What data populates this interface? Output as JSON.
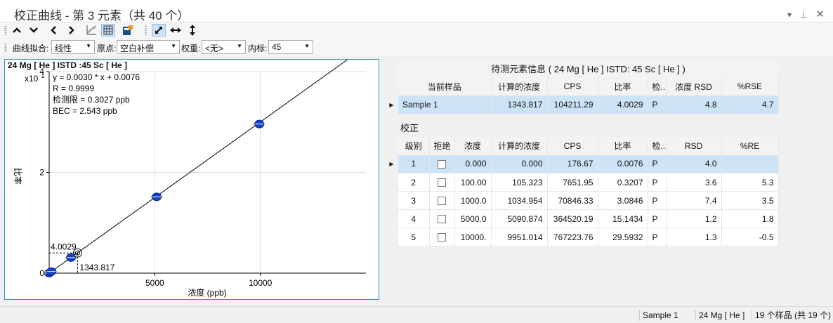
{
  "window": {
    "title": "校正曲线 - 第 3 元素（共 40 个）",
    "controls": [
      "▾",
      "⊥",
      "✕"
    ]
  },
  "toolbar": {
    "icons": [
      "chevron-up-icon",
      "chevron-down-icon",
      "chevron-left-icon",
      "chevron-right-icon",
      "chart-axes-icon",
      "grid-table-icon",
      "report-icon",
      "fit-expand-icon",
      "horizontal-resize-icon",
      "vertical-resize-icon"
    ]
  },
  "options": {
    "fit_label": "曲线拟合:",
    "fit_value": "线性",
    "origin_label": "原点:",
    "origin_value": "空白补偿",
    "weight_label": "权重:",
    "weight_value": "<无>",
    "istd_label": "内标:",
    "istd_value": "45"
  },
  "chart_title": "24  Mg  [ He ]  ISTD :45  Sc  [ He ]",
  "chart_data": {
    "type": "scatter",
    "multiplier": "x10",
    "multiplier_exp": "1",
    "xlabel": "浓度 (ppb)",
    "ylabel": "比率",
    "xlim": [
      0,
      15000
    ],
    "ylim": [
      0,
      40
    ],
    "xticks": [
      5000,
      10000
    ],
    "yticks": [
      0,
      2,
      4
    ],
    "ytick_values": [
      0,
      20,
      40
    ],
    "grid": true,
    "fit_line": {
      "slope": 0.003,
      "intercept": 0.0076,
      "x_end": 15000
    },
    "points": [
      {
        "x": 0,
        "y": 0.0076
      },
      {
        "x": 105.323,
        "y": 0.3207
      },
      {
        "x": 1034.954,
        "y": 3.0846
      },
      {
        "x": 5090.874,
        "y": 15.1434
      },
      {
        "x": 9951.014,
        "y": 29.5932
      }
    ],
    "sample_point": {
      "x": 1343.817,
      "y": 4.0029
    },
    "sample_y_label": "4.0029",
    "sample_x_label": "1343.817",
    "stats": [
      "y = 0.0030 * x  + 0.0076",
      "R =  0.9999",
      "检测限 = 0.3027 ppb",
      "BEC = 2.543 ppb"
    ]
  },
  "info_table": {
    "caption": "待测元素信息 ( 24  Mg  [ He ]  ISTD: 45  Sc  [ He ] )",
    "headers": [
      "当前样品",
      "计算的浓度",
      "CPS",
      "比率",
      "检...",
      "浓度 RSD",
      "%RSE"
    ],
    "row": [
      "Sample 1",
      "1343.817",
      "104211.29",
      "4.0029",
      "P",
      "4.8",
      "4.7"
    ]
  },
  "calib_table": {
    "section": "校正",
    "headers": [
      "级别",
      "拒绝",
      "浓度",
      "计算的浓度",
      "CPS",
      "比率",
      "检...",
      "RSD",
      "%RE"
    ],
    "rows": [
      [
        "1",
        "",
        "0.000",
        "0.000",
        "176.67",
        "0.0076",
        "P",
        "4.0",
        ""
      ],
      [
        "2",
        "",
        "100.00",
        "105.323",
        "7651.95",
        "0.3207",
        "P",
        "3.6",
        "5.3"
      ],
      [
        "3",
        "",
        "1000.0",
        "1034.954",
        "70846.33",
        "3.0846",
        "P",
        "7.4",
        "3.5"
      ],
      [
        "4",
        "",
        "5000.0",
        "5090.874",
        "364520.19",
        "15.1434",
        "P",
        "1.2",
        "1.8"
      ],
      [
        "5",
        "",
        "10000.",
        "9951.014",
        "767223.76",
        "29.5932",
        "P",
        "1.3",
        "-0.5"
      ]
    ]
  },
  "status": {
    "sample": "Sample 1",
    "element": "24  Mg  [ He ]",
    "count": "19 个样品 (共 19 个)"
  }
}
